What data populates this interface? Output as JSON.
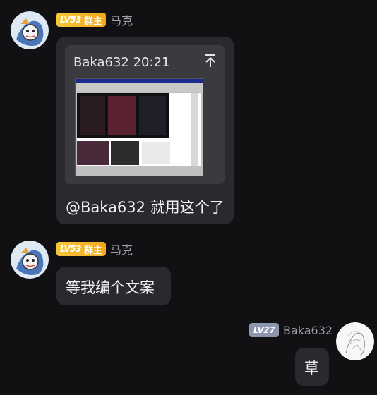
{
  "messages": [
    {
      "sender": "马克",
      "level": "LV53",
      "role": "群主",
      "quote": {
        "author": "Baka632",
        "time": "20:21"
      },
      "text": "@Baka632 就用这个了"
    },
    {
      "sender": "马克",
      "level": "LV53",
      "role": "群主",
      "text": "等我编个文案"
    },
    {
      "sender": "Baka632",
      "level": "LV27",
      "text": "草"
    }
  ],
  "colors": {
    "background": "#111113",
    "bubble": "#2a2a2e",
    "badge_gold": "#f7c63a",
    "badge_gray": "#8c96ad"
  },
  "icons": [
    "avatar-marker-icon",
    "pin-icon"
  ]
}
